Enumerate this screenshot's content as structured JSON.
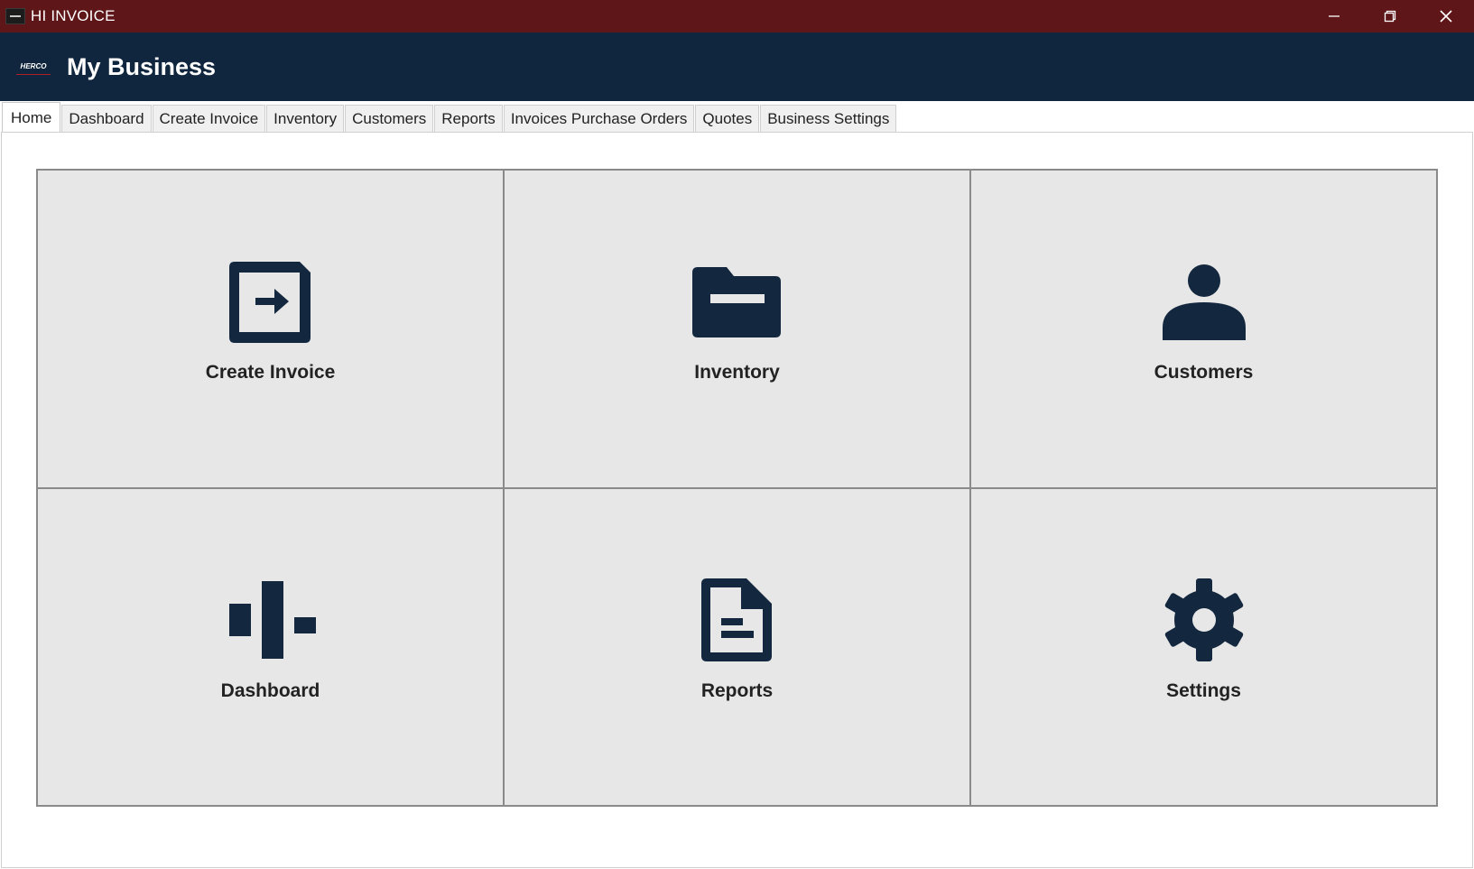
{
  "window": {
    "title": "HI INVOICE",
    "controls": {
      "minimize": "—",
      "restore": "❐",
      "close": "✕"
    }
  },
  "header": {
    "logo_text": "HERCO",
    "business_name": "My Business"
  },
  "tabs": [
    {
      "label": "Home",
      "active": true
    },
    {
      "label": "Dashboard"
    },
    {
      "label": "Create Invoice"
    },
    {
      "label": "Inventory"
    },
    {
      "label": "Customers"
    },
    {
      "label": "Reports"
    },
    {
      "label": "Invoices Purchase Orders"
    },
    {
      "label": "Quotes"
    },
    {
      "label": "Business Settings"
    }
  ],
  "tiles": [
    {
      "label": "Create Invoice",
      "icon": "create-invoice-icon"
    },
    {
      "label": "Inventory",
      "icon": "folder-icon"
    },
    {
      "label": "Customers",
      "icon": "person-icon"
    },
    {
      "label": "Dashboard",
      "icon": "dashboard-icon"
    },
    {
      "label": "Reports",
      "icon": "report-document-icon"
    },
    {
      "label": "Settings",
      "icon": "gear-icon"
    }
  ],
  "colors": {
    "titlebar": "#5e1619",
    "header": "#10263f",
    "icon": "#13273f",
    "tile_bg": "#e7e7e7"
  }
}
